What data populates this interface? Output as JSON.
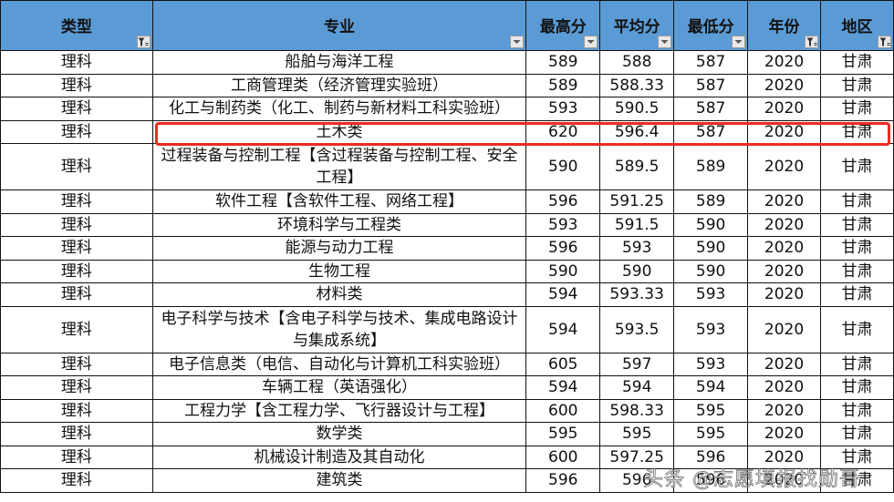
{
  "headers": [
    {
      "label": "类型",
      "filter": "active"
    },
    {
      "label": "专业",
      "filter": "dropdown"
    },
    {
      "label": "最高分",
      "filter": "dropdown"
    },
    {
      "label": "平均分",
      "filter": "dropdown"
    },
    {
      "label": "最低分",
      "filter": "dropdown"
    },
    {
      "label": "年份",
      "filter": "active"
    },
    {
      "label": "地区",
      "filter": "active"
    }
  ],
  "rows": [
    {
      "type": "理科",
      "major": "船舶与海洋工程",
      "max": "589",
      "avg": "588",
      "min": "587",
      "year": "2020",
      "region": "甘肃"
    },
    {
      "type": "理科",
      "major": "工商管理类（经济管理实验班）",
      "max": "589",
      "avg": "588.33",
      "min": "587",
      "year": "2020",
      "region": "甘肃"
    },
    {
      "type": "理科",
      "major": "化工与制药类（化工、制药与新材料工科实验班）",
      "max": "593",
      "avg": "590.5",
      "min": "587",
      "year": "2020",
      "region": "甘肃"
    },
    {
      "type": "理科",
      "major": "土木类",
      "max": "620",
      "avg": "596.4",
      "min": "587",
      "year": "2020",
      "region": "甘肃",
      "highlighted": true
    },
    {
      "type": "理科",
      "major": "过程装备与控制工程【含过程装备与控制工程、安全工程】",
      "max": "590",
      "avg": "589.5",
      "min": "589",
      "year": "2020",
      "region": "甘肃"
    },
    {
      "type": "理科",
      "major": "软件工程【含软件工程、网络工程】",
      "max": "596",
      "avg": "591.25",
      "min": "589",
      "year": "2020",
      "region": "甘肃"
    },
    {
      "type": "理科",
      "major": "环境科学与工程类",
      "max": "593",
      "avg": "591.5",
      "min": "590",
      "year": "2020",
      "region": "甘肃"
    },
    {
      "type": "理科",
      "major": "能源与动力工程",
      "max": "596",
      "avg": "593",
      "min": "590",
      "year": "2020",
      "region": "甘肃"
    },
    {
      "type": "理科",
      "major": "生物工程",
      "max": "590",
      "avg": "590",
      "min": "590",
      "year": "2020",
      "region": "甘肃"
    },
    {
      "type": "理科",
      "major": "材料类",
      "max": "594",
      "avg": "593.33",
      "min": "593",
      "year": "2020",
      "region": "甘肃"
    },
    {
      "type": "理科",
      "major": "电子科学与技术【含电子科学与技术、集成电路设计与集成系统】",
      "max": "594",
      "avg": "593.5",
      "min": "593",
      "year": "2020",
      "region": "甘肃"
    },
    {
      "type": "理科",
      "major": "电子信息类（电信、自动化与计算机工科实验班）",
      "max": "605",
      "avg": "597",
      "min": "593",
      "year": "2020",
      "region": "甘肃"
    },
    {
      "type": "理科",
      "major": "车辆工程（英语强化）",
      "max": "594",
      "avg": "594",
      "min": "594",
      "year": "2020",
      "region": "甘肃"
    },
    {
      "type": "理科",
      "major": "工程力学【含工程力学、飞行器设计与工程】",
      "max": "600",
      "avg": "598.33",
      "min": "595",
      "year": "2020",
      "region": "甘肃"
    },
    {
      "type": "理科",
      "major": "数学类",
      "max": "595",
      "avg": "595",
      "min": "595",
      "year": "2020",
      "region": "甘肃"
    },
    {
      "type": "理科",
      "major": "机械设计制造及其自动化",
      "max": "600",
      "avg": "597.25",
      "min": "596",
      "year": "2020",
      "region": "甘肃"
    },
    {
      "type": "理科",
      "major": "建筑类",
      "max": "596",
      "avg": "596",
      "min": "596",
      "year": "2020",
      "region": "甘肃"
    }
  ],
  "highlight_color": "#ee2a24",
  "header_color": "#5b9bd5",
  "watermark": "头条 @志愿填报找勋哥"
}
